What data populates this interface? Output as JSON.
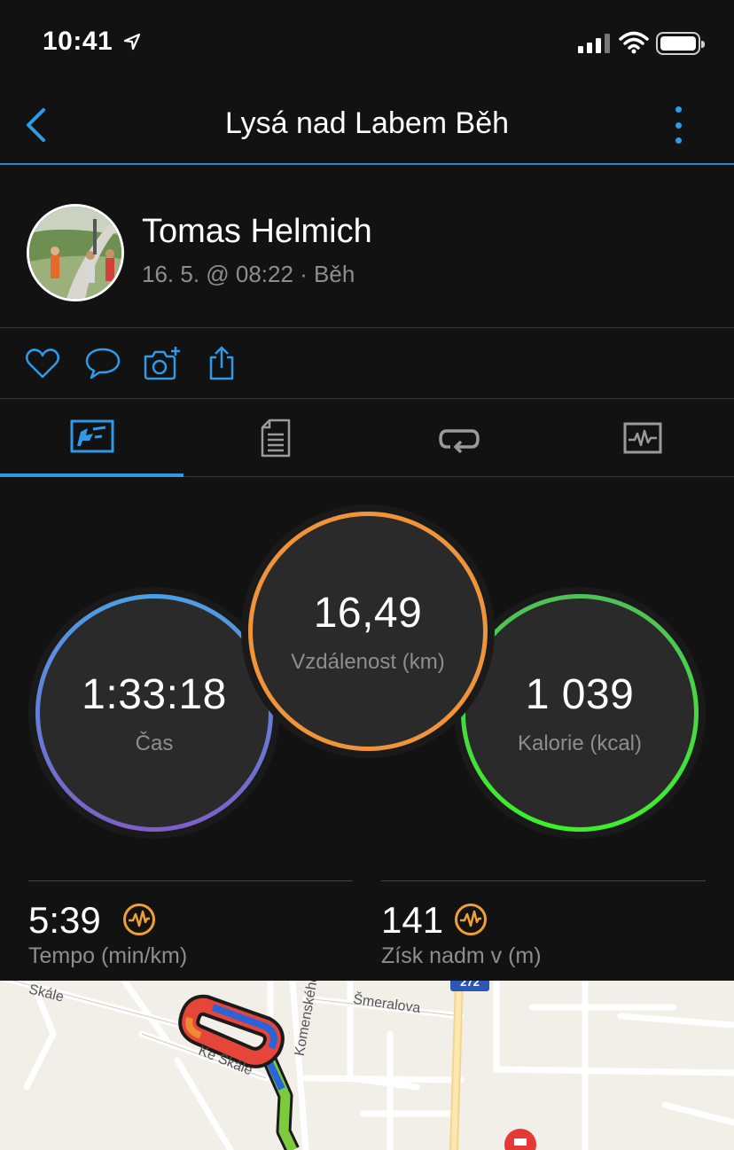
{
  "status_bar": {
    "time": "10:41"
  },
  "nav": {
    "title": "Lysá nad Labem Běh"
  },
  "profile": {
    "name": "Tomas Helmich",
    "meta": "16. 5. @ 08:22 · Běh"
  },
  "tabs": [
    {
      "name": "summary",
      "icon": "overview-icon",
      "active": true
    },
    {
      "name": "details",
      "icon": "document-list-icon",
      "active": false
    },
    {
      "name": "laps",
      "icon": "loop-icon",
      "active": false
    },
    {
      "name": "charts",
      "icon": "activity-chart-icon",
      "active": false
    }
  ],
  "stats": {
    "time": {
      "value": "1:33:18",
      "label": "Čas"
    },
    "distance": {
      "value": "16,49",
      "label": "Vzdálenost (km)"
    },
    "calories": {
      "value": "1 039",
      "label": "Kalorie (kcal)"
    }
  },
  "metrics": {
    "pace": {
      "value": "5:39",
      "label": "Tempo (min/km)"
    },
    "elevation": {
      "value": "141",
      "label": "Získ nadm v (m)"
    }
  },
  "map": {
    "streets": [
      "Skále",
      "Ke Skále",
      "Komenského",
      "Šmeralova"
    ],
    "road_shield": "272"
  },
  "colors": {
    "accent": "#2f9be8",
    "distance_ring": "#f0943a",
    "time_ring_start": "#4b9fe6",
    "time_ring_end": "#7d5fc8",
    "calories_ring": "#3df02a",
    "performance_icon": "#f0a030"
  }
}
